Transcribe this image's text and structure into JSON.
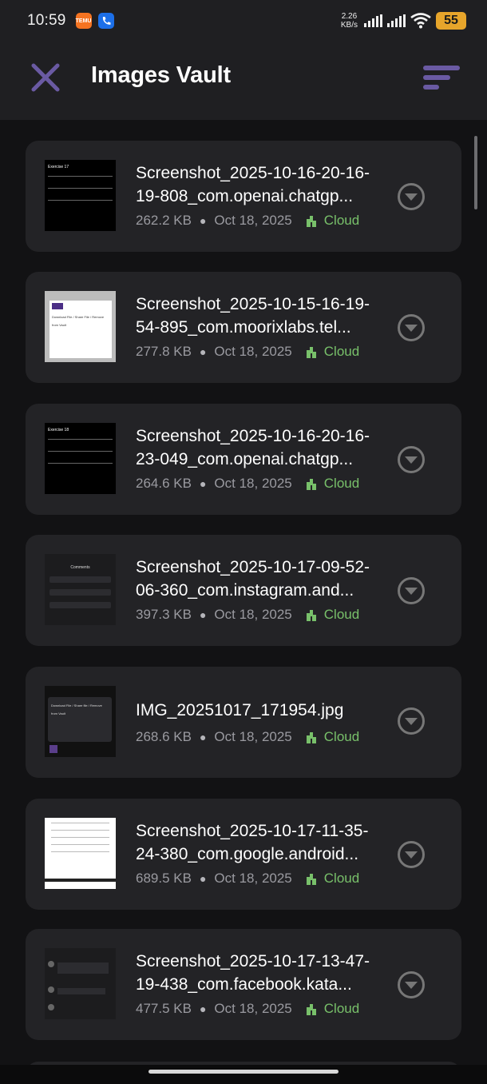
{
  "status_bar": {
    "time": "10:59",
    "temu_label": "ष्ट्रक्\nTEMU",
    "speed_value": "2.26",
    "speed_unit": "KB/s",
    "battery": "55"
  },
  "header": {
    "title": "Images Vault",
    "close_icon": "close-icon",
    "sort_icon": "sort-icon"
  },
  "colors": {
    "accent": "#6a5aa3",
    "cloud_green": "#78c06a",
    "card_bg": "#232326",
    "page_bg": "#121214"
  },
  "files": [
    {
      "name": "Screenshot_2025-10-16-20-16-19-808_com.openai.chatgp...",
      "size": "262.2 KB",
      "date": "Oct 18, 2025",
      "location": "Cloud"
    },
    {
      "name": "Screenshot_2025-10-15-16-19-54-895_com.moorixlabs.tel...",
      "size": "277.8 KB",
      "date": "Oct 18, 2025",
      "location": "Cloud"
    },
    {
      "name": "Screenshot_2025-10-16-20-16-23-049_com.openai.chatgp...",
      "size": "264.6 KB",
      "date": "Oct 18, 2025",
      "location": "Cloud"
    },
    {
      "name": "Screenshot_2025-10-17-09-52-06-360_com.instagram.and...",
      "size": "397.3 KB",
      "date": "Oct 18, 2025",
      "location": "Cloud"
    },
    {
      "name": "IMG_20251017_171954.jpg",
      "size": "268.6 KB",
      "date": "Oct 18, 2025",
      "location": "Cloud"
    },
    {
      "name": "Screenshot_2025-10-17-11-35-24-380_com.google.android...",
      "size": "689.5 KB",
      "date": "Oct 18, 2025",
      "location": "Cloud"
    },
    {
      "name": "Screenshot_2025-10-17-13-47-19-438_com.facebook.kata...",
      "size": "477.5 KB",
      "date": "Oct 18, 2025",
      "location": "Cloud"
    }
  ],
  "thumbnails": [
    {
      "caption": "Exercise 17"
    },
    {
      "caption": "Download File / Share File / Remove from Vault"
    },
    {
      "caption": "Exercise 18"
    },
    {
      "caption": "Comments"
    },
    {
      "caption": "Download File / Share file / Remove from Vault"
    },
    {
      "caption": ""
    },
    {
      "caption": ""
    }
  ]
}
